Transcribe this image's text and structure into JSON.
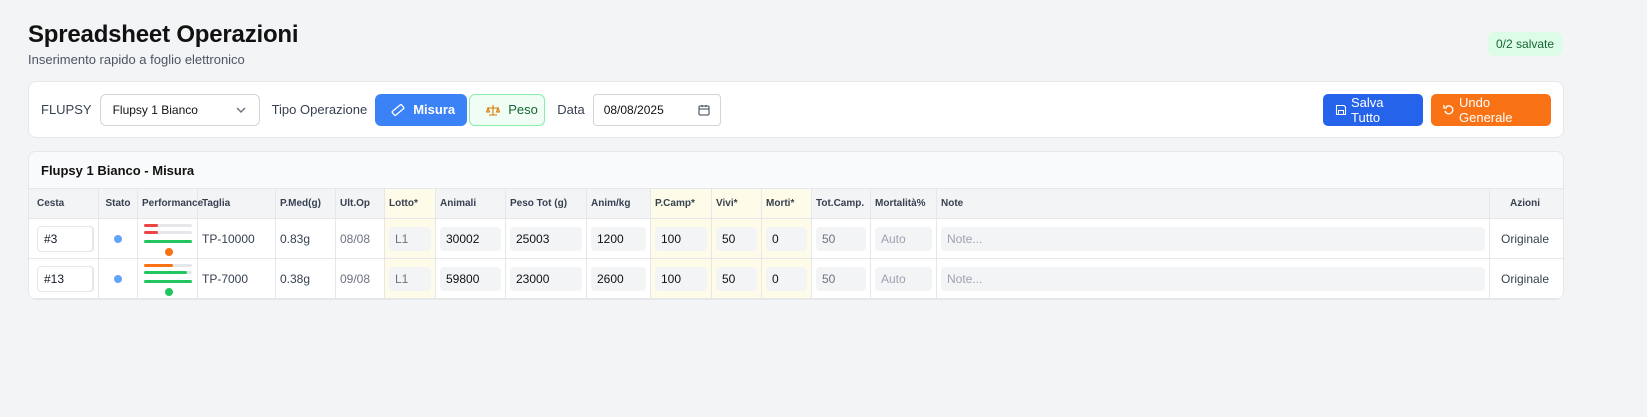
{
  "header": {
    "title": "Spreadsheet Operazioni",
    "subtitle": "Inserimento rapido a foglio elettronico"
  },
  "saved_badge": "0/2 salvate",
  "toolbar": {
    "flupsy_label": "FLUPSY",
    "flupsy_value": "Flupsy 1 Bianco",
    "op_type_label": "Tipo Operazione",
    "op_misura": "Misura",
    "op_peso": "Peso",
    "date_label": "Data",
    "date_value": "08/08/2025",
    "save_all": "Salva Tutto",
    "undo_all": "Undo Generale"
  },
  "grid": {
    "title": "Flupsy 1 Bianco - Misura",
    "columns": [
      "Cesta",
      "Stato",
      "Performance",
      "Taglia",
      "P.Med(g)",
      "Ult.Op",
      "Lotto*",
      "Animali",
      "Peso Tot (g)",
      "Anim/kg",
      "P.Camp*",
      "Vivi*",
      "Morti*",
      "Tot.Camp.",
      "Mortalità%",
      "Note",
      "Azioni"
    ],
    "rows": [
      {
        "cesta": "#3",
        "taglia": "TP-10000",
        "pmed": "0.83g",
        "ultop": "08/08",
        "lotto": "L1",
        "animali": "30002",
        "peso_tot": "25003",
        "anim_kg": "1200",
        "pcamp": "100",
        "vivi": "50",
        "morti": "0",
        "tot_camp": "50",
        "mortalita": "Auto",
        "note": "Note...",
        "azioni": "Originale",
        "perf": {
          "bar1": 0.3,
          "bar1_color": "#ef4444",
          "bar2": 0.3,
          "bar2_color": "#ef4444",
          "bar3": 1.0,
          "bar3_color": "#22c55e",
          "dot_color": "#f97316"
        }
      },
      {
        "cesta": "#13",
        "taglia": "TP-7000",
        "pmed": "0.38g",
        "ultop": "09/08",
        "lotto": "L1",
        "animali": "59800",
        "peso_tot": "23000",
        "anim_kg": "2600",
        "pcamp": "100",
        "vivi": "50",
        "morti": "0",
        "tot_camp": "50",
        "mortalita": "Auto",
        "note": "Note...",
        "azioni": "Originale",
        "perf": {
          "bar1": 0.6,
          "bar1_color": "#f97316",
          "bar2": 0.9,
          "bar2_color": "#22c55e",
          "bar3": 1.0,
          "bar3_color": "#22c55e",
          "dot_color": "#22c55e"
        }
      }
    ]
  },
  "colors": {
    "primary": "#3b82f6",
    "save": "#2563eb",
    "undo": "#f97316",
    "status_dot": "#60a5fa"
  }
}
